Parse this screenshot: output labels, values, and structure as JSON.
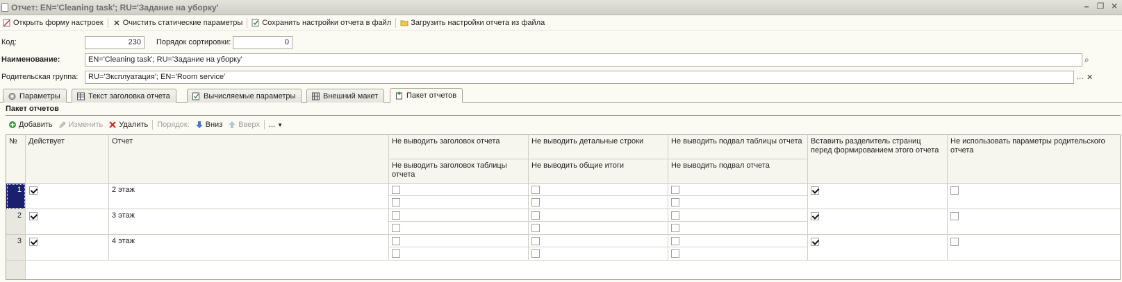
{
  "window": {
    "title": "Отчет: EN='Cleaning task'; RU='Задание на уборку'"
  },
  "commands": {
    "open_settings": "Открыть форму настроек",
    "clear_static": "Очистить статические параметры",
    "save_settings": "Сохранить настройки отчета в файл",
    "load_settings": "Загрузить настройки отчета из файла"
  },
  "form": {
    "code_label": "Код:",
    "code_value": "230",
    "sort_label": "Порядок сортировки:",
    "sort_value": "0",
    "name_label": "Наименование:",
    "name_value": "EN='Cleaning task'; RU='Задание на уборку'",
    "parent_label": "Родительская группа:",
    "parent_value": "RU='Эксплуатация'; EN='Room service'"
  },
  "tabs": [
    {
      "label": "Параметры",
      "icon": "gear-icon"
    },
    {
      "label": "Текст заголовка отчета",
      "icon": "table-icon"
    },
    {
      "label": "Вычисляемые параметры",
      "icon": "calc-icon"
    },
    {
      "label": "Внешний макет",
      "icon": "grid-icon"
    },
    {
      "label": "Пакет отчетов",
      "icon": "package-icon"
    }
  ],
  "package": {
    "title": "Пакет отчетов",
    "toolbar": {
      "add": "Добавить",
      "edit": "Изменить",
      "delete": "Удалить",
      "order": "Порядок:",
      "down": "Вниз",
      "up": "Вверх",
      "more": "..."
    },
    "columns": {
      "num": "№",
      "active": "Действует",
      "report": "Отчет",
      "no_header": "Не выводить заголовок отчета",
      "no_table_header": "Не выводить заголовок таблицы отчета",
      "no_detail": "Не выводить детальные строки",
      "no_totals": "Не выводить общие итоги",
      "no_table_footer": "Не выводить подвал таблицы отчета",
      "no_footer": "Не выводить подвал отчета",
      "page_break": "Вставить разделитель страниц перед формированием этого отчета",
      "no_parent_params": "Не использовать параметры родительского отчета"
    },
    "rows": [
      {
        "num": "1",
        "active": true,
        "report": "2 этаж",
        "page_break": true,
        "no_parent_params": false
      },
      {
        "num": "2",
        "active": true,
        "report": "3 этаж",
        "page_break": true,
        "no_parent_params": false
      },
      {
        "num": "3",
        "active": true,
        "report": "4 этаж",
        "page_break": true,
        "no_parent_params": false
      }
    ]
  }
}
